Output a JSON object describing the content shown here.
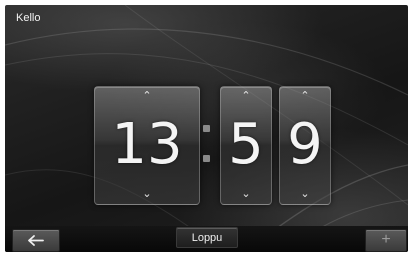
{
  "header": {
    "title": "Kello"
  },
  "time": {
    "hours": "13",
    "minutes": "5",
    "seconds": "9"
  },
  "icons": {
    "up": "chevron-up-icon",
    "down": "chevron-down-icon",
    "back": "arrow-left-icon",
    "add": "plus-icon"
  },
  "glyphs": {
    "up": "⌃",
    "down": "⌄",
    "back": "🡐",
    "add": "+"
  },
  "footer": {
    "end_label": "Loppu"
  }
}
